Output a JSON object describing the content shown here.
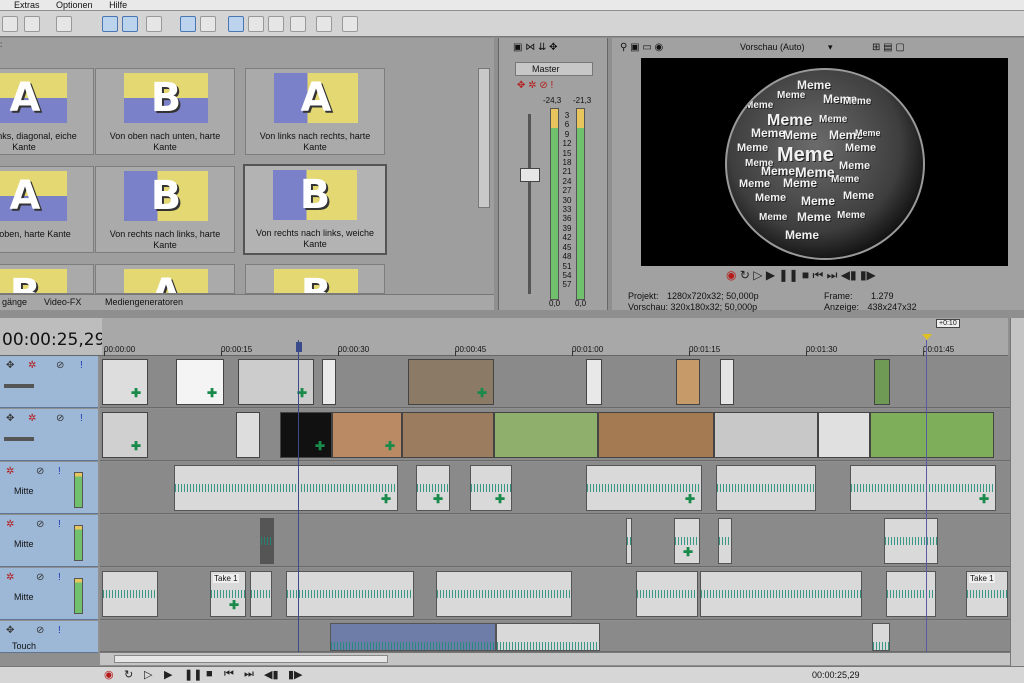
{
  "menu": [
    "Extras",
    "Optionen",
    "Hilfe"
  ],
  "transitions": {
    "tiles": [
      {
        "label": "nach links, diagonal, eiche Kante",
        "glyph": "A"
      },
      {
        "label": "Von oben nach unten, harte Kante",
        "glyph": "B"
      },
      {
        "label": "Von links nach rechts, harte Kante",
        "glyph": "A"
      },
      {
        "label": "nach oben, harte Kante",
        "glyph": "A"
      },
      {
        "label": "Von rechts nach links, harte Kante",
        "glyph": "B"
      },
      {
        "label": "Von rechts nach links, weiche Kante",
        "glyph": "B"
      },
      {
        "label": "",
        "glyph": "B"
      },
      {
        "label": "",
        "glyph": "A"
      },
      {
        "label": "",
        "glyph": "B"
      }
    ],
    "tabs": [
      "gänge",
      "Video-FX",
      "Mediengeneratoren"
    ]
  },
  "mixer": {
    "title": "Master",
    "left_db": "-24,3",
    "right_db": "-21,3",
    "scale": [
      "3",
      "6",
      "9",
      "12",
      "15",
      "18",
      "21",
      "24",
      "27",
      "30",
      "33",
      "36",
      "39",
      "42",
      "45",
      "48",
      "51",
      "54",
      "57"
    ],
    "bottom_left": "0,0",
    "bottom_right": "0,0"
  },
  "preview": {
    "mode_label": "Vorschau (Auto)",
    "words": [
      "Meme",
      "Meme",
      "Meme",
      "Meme",
      "Meme",
      "Meme",
      "Meme",
      "Meme",
      "Meme",
      "Meme",
      "Meme",
      "Meme",
      "Meme",
      "Meme",
      "Meme",
      "Meme",
      "Meme",
      "Meme",
      "Meme",
      "Meme",
      "Meme",
      "Meme",
      "Meme",
      "Meme",
      "Meme",
      "Meme",
      "Meme",
      "Meme"
    ],
    "project_label": "Projekt:",
    "project_value": "1280x720x32; 50,000p",
    "vorschau_label": "Vorschau:",
    "vorschau_value": "320x180x32; 50,000p",
    "frame_label": "Frame:",
    "frame_value": "1.279",
    "anzeige_label": "Anzeige:",
    "anzeige_value": "438x247x32"
  },
  "timeline": {
    "timecode": "00:00:25,29",
    "marker_label": "+0:10",
    "ruler": [
      "00:00:00",
      "00:00:15",
      "00:00:30",
      "00:00:45",
      "00:01:00",
      "00:01:15",
      "00:01:30",
      "00:01:45"
    ],
    "tracks": [
      {
        "type": "video",
        "label": ""
      },
      {
        "type": "video",
        "label": ""
      },
      {
        "type": "audio",
        "label": "Mitte"
      },
      {
        "type": "audio",
        "label": "Mitte"
      },
      {
        "type": "audio",
        "label": "Mitte"
      },
      {
        "type": "audio",
        "label": "Touch"
      }
    ],
    "take_labels": [
      "Take 1",
      "Take 1"
    ],
    "bottom_timecode": "00:00:25,29"
  },
  "colors": {
    "track_header": "#9db8d6",
    "waveform": "#1e8c78",
    "cursor": "#3b4a8a",
    "meter": "#71c06e"
  }
}
